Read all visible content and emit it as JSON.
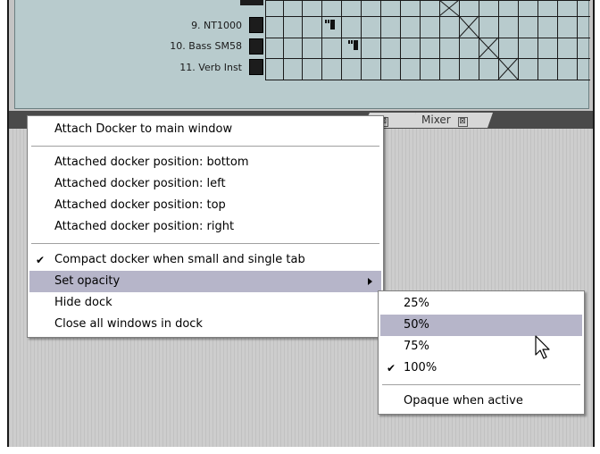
{
  "tracks": [
    {
      "label": "9. NT1000"
    },
    {
      "label": "10. Bass SM58"
    },
    {
      "label": "11. Verb Inst"
    }
  ],
  "tabs": [
    {
      "label": "",
      "close": "⊠"
    },
    {
      "label": "Mixer",
      "close": "⊠"
    }
  ],
  "context_menu": {
    "items": [
      {
        "label": "Attach Docker to main window"
      },
      {
        "label": "Attached docker position: bottom"
      },
      {
        "label": "Attached docker position: left"
      },
      {
        "label": "Attached docker position: top"
      },
      {
        "label": "Attached docker position: right"
      },
      {
        "label": "Compact docker when small and single tab",
        "checked": true
      },
      {
        "label": "Set opacity",
        "submenu": true,
        "highlighted": true
      },
      {
        "label": "Hide dock"
      },
      {
        "label": "Close all windows in dock"
      }
    ]
  },
  "opacity_submenu": {
    "items": [
      {
        "label": "25%"
      },
      {
        "label": "50%",
        "highlighted": true
      },
      {
        "label": "75%"
      },
      {
        "label": "100%",
        "checked": true
      },
      {
        "label": "Opaque when active"
      }
    ]
  },
  "colors": {
    "highlight": "#b6b5c9",
    "routing_bg": "#b8cbcd"
  }
}
